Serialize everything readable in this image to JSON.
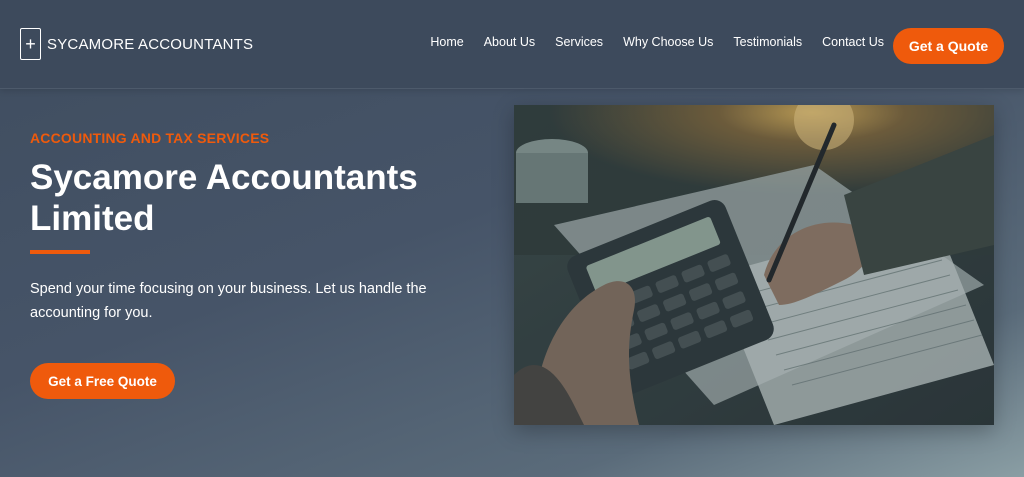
{
  "header": {
    "logo_mark": "+",
    "brand": "SYCAMORE ACCOUNTANTS",
    "nav": [
      "Home",
      "About Us",
      "Services",
      "Why Choose Us",
      "Testimonials",
      "Contact Us"
    ],
    "cta_label": "Get a Quote"
  },
  "hero": {
    "eyebrow": "ACCOUNTING AND TAX SERVICES",
    "title": "Sycamore Accountants Limited",
    "subtitle": "Spend your time focusing on your business. Let us handle the accounting for you.",
    "cta_label": "Get a Free Quote",
    "image_icon": "accountant-calculator-photo"
  },
  "colors": {
    "accent": "#ef5a0c",
    "header_bg": "#3d4a5c",
    "hero_bg": "#465468"
  }
}
